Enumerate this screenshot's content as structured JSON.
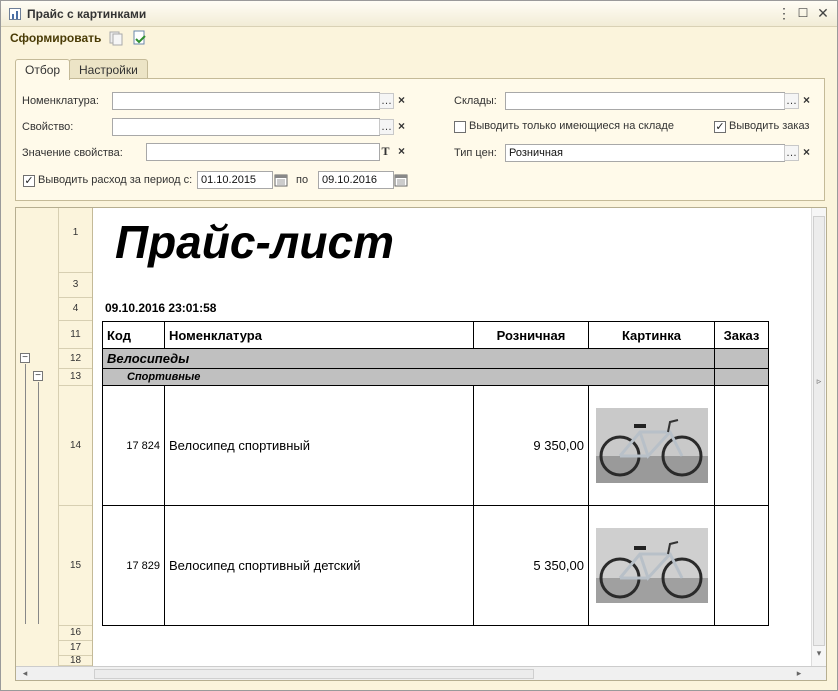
{
  "window": {
    "title": "Прайс с картинками"
  },
  "toolbar": {
    "generate_label": "Сформировать"
  },
  "tabs": [
    {
      "label": "Отбор"
    },
    {
      "label": "Настройки"
    }
  ],
  "filters": {
    "nomenclature": {
      "label": "Номенклатура:",
      "value": ""
    },
    "property": {
      "label": "Свойство:",
      "value": ""
    },
    "property_value": {
      "label": "Значение свойства:",
      "value": ""
    },
    "period": {
      "checkbox_label": "Выводить расход за период с:",
      "checked": true,
      "from": "01.10.2015",
      "to_label": "по",
      "to": "09.10.2016"
    },
    "warehouses": {
      "label": "Склады:",
      "value": ""
    },
    "only_in_stock": {
      "label": "Выводить только имеющиеся на складе",
      "checked": false
    },
    "show_order": {
      "label": "Выводить заказ",
      "checked": true
    },
    "price_type": {
      "label": "Тип цен:",
      "value": "Розничная"
    }
  },
  "report": {
    "title": "Прайс-лист",
    "datetime": "09.10.2016 23:01:58",
    "row_numbers": [
      "1",
      "3",
      "4",
      "11",
      "12",
      "13",
      "14",
      "15",
      "16",
      "17",
      "18"
    ],
    "columns": {
      "code": "Код",
      "nomenclature": "Номенклатура",
      "price": "Розничная",
      "picture": "Картинка",
      "order": "Заказ"
    },
    "group": "Велосипеды",
    "subgroup": "Спортивные",
    "items": [
      {
        "code": "17 824",
        "name": "Велосипед спортивный",
        "price": "9 350,00",
        "picture": "bicycle-photo"
      },
      {
        "code": "17 829",
        "name": "Велосипед спортивный детский",
        "price": "5 350,00",
        "picture": "bicycle-photo"
      }
    ]
  }
}
